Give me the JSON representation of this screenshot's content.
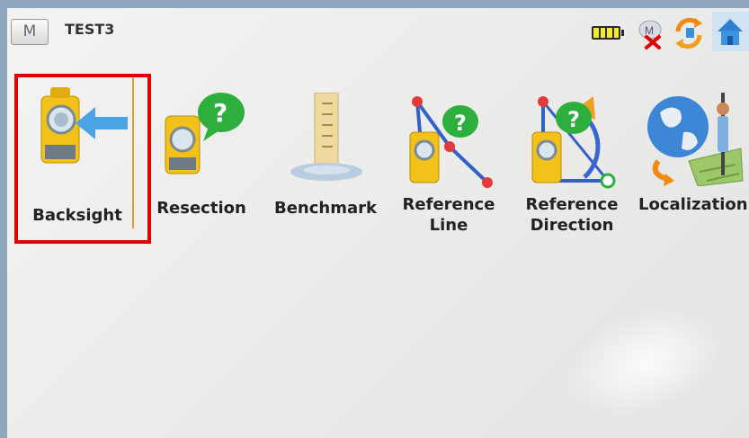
{
  "app": {
    "menu_label": "M",
    "job_title": "TEST3"
  },
  "status_icons": {
    "battery": "battery-icon",
    "connection": "radio-disconnected-icon",
    "sync": "sync-icon",
    "home": "home-icon"
  },
  "tiles": [
    {
      "label": "Backsight",
      "icon": "backsight-icon",
      "selected": true
    },
    {
      "label": "Resection",
      "icon": "resection-icon"
    },
    {
      "label": "Benchmark",
      "icon": "benchmark-icon"
    },
    {
      "label_line1": "Reference",
      "label_line2": "Line",
      "icon": "reference-line-icon"
    },
    {
      "label_line1": "Reference",
      "label_line2": "Direction",
      "icon": "reference-direction-icon"
    },
    {
      "label": "Localization",
      "icon": "localization-icon"
    }
  ],
  "colors": {
    "selection": "#e00000",
    "instrument_yellow": "#f2c21a",
    "question_green": "#2eae3c"
  }
}
